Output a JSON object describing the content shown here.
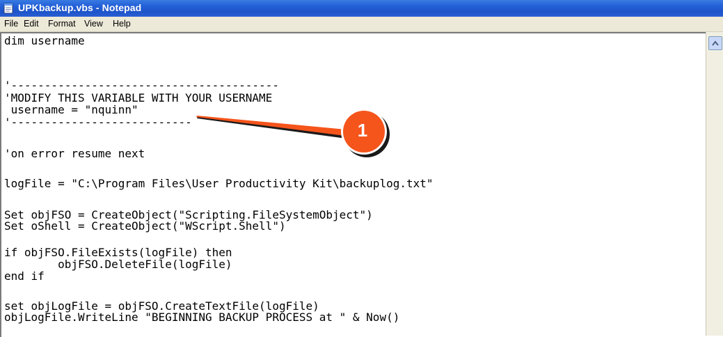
{
  "window": {
    "title": "UPKbackup.vbs - Notepad"
  },
  "menu": [
    {
      "label": "File"
    },
    {
      "label": "Edit"
    },
    {
      "label": "Format"
    },
    {
      "label": "View"
    },
    {
      "label": "Help"
    }
  ],
  "editor": {
    "lines": [
      "dim username",
      "",
      "'----------------------------------------",
      "'MODIFY THIS VARIABLE WITH YOUR USERNAME",
      " username = \"nquinn\"",
      "'---------------------------",
      "",
      "'on error resume next",
      "",
      "logFile = \"C:\\Program Files\\User Productivity Kit\\backuplog.txt\"",
      "",
      "Set objFSO = CreateObject(\"Scripting.FileSystemObject\")",
      "Set oShell = CreateObject(\"WScript.Shell\")",
      "",
      "if objFSO.FileExists(logFile) then",
      "        objFSO.DeleteFile(logFile)",
      "end if",
      "",
      "set objLogFile = objFSO.CreateTextFile(logFile)",
      "objLogFile.WriteLine \"BEGINNING BACKUP PROCESS at \" & Now()"
    ]
  },
  "callout": {
    "number": "1",
    "color": "#f5541b"
  },
  "icons": {
    "app": "notepad-icon",
    "scroll_up": "scroll-up-arrow-icon"
  }
}
